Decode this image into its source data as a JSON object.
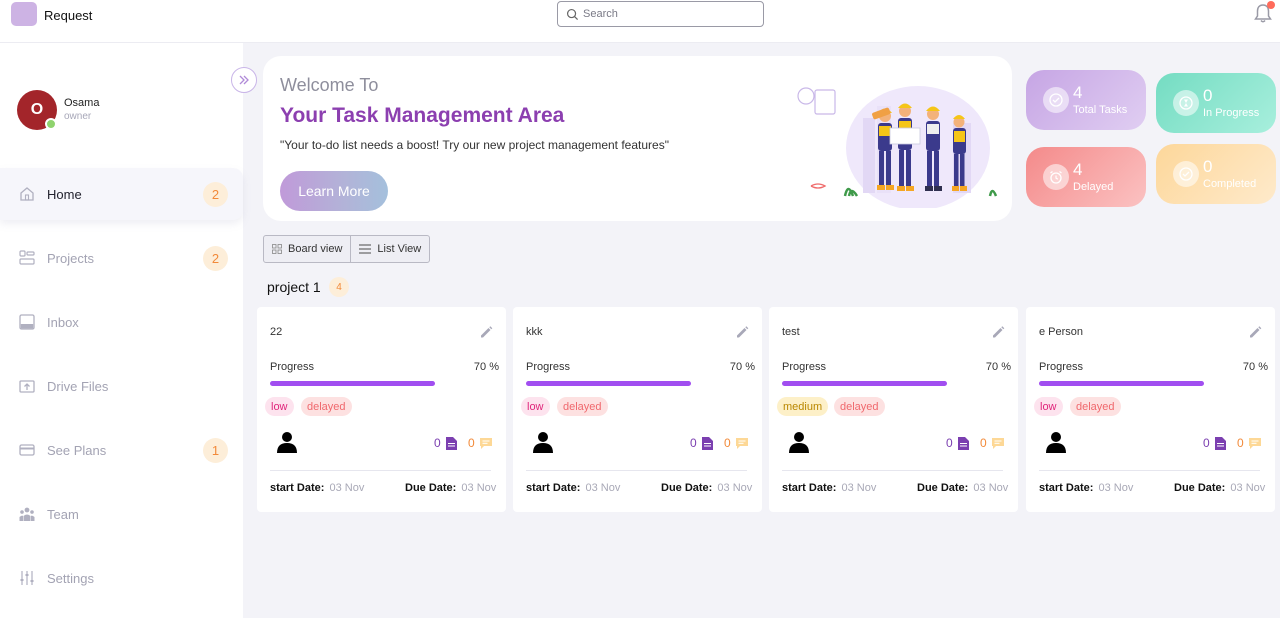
{
  "app": {
    "title": "Request"
  },
  "search": {
    "placeholder": "Search"
  },
  "user": {
    "initial": "O",
    "name": "Osama",
    "role": "owner"
  },
  "sidebar": {
    "items": [
      {
        "key": "home",
        "label": "Home",
        "badge": "2",
        "active": true
      },
      {
        "key": "projects",
        "label": "Projects",
        "badge": "2"
      },
      {
        "key": "inbox",
        "label": "Inbox",
        "badge": ""
      },
      {
        "key": "drive-files",
        "label": "Drive Files",
        "badge": ""
      },
      {
        "key": "see-plans",
        "label": "See Plans",
        "badge": "1"
      },
      {
        "key": "team",
        "label": "Team",
        "badge": ""
      },
      {
        "key": "settings",
        "label": "Settings",
        "badge": ""
      }
    ]
  },
  "hero": {
    "welcome": "Welcome To",
    "title": "Your Task Management Area",
    "subtitle": "\"Your to-do list needs a boost! Try our new project management features\"",
    "button": "Learn More"
  },
  "stats": [
    {
      "key": "total",
      "value": "4",
      "label": "Total Tasks",
      "color": "#d4b5ec"
    },
    {
      "key": "progress",
      "value": "0",
      "label": "In Progress",
      "color": "#8fe3cf"
    },
    {
      "key": "delayed",
      "value": "4",
      "label": "Delayed",
      "color": "#f7a2a2"
    },
    {
      "key": "completed",
      "value": "0",
      "label": "Completed",
      "color": "#fde1a9"
    }
  ],
  "views": {
    "board": "Board view",
    "list": "List View"
  },
  "project": {
    "name": "project 1",
    "count": "4"
  },
  "tasks": [
    {
      "name": "22",
      "progress_label": "Progress",
      "progress_text": "70 %",
      "progress": 0.7,
      "priority": "low",
      "status": "delayed",
      "files": "0",
      "comments": "0",
      "start_label": "start Date:",
      "start": "03 Nov",
      "due_label": "Due Date:",
      "due": "03 Nov"
    },
    {
      "name": "kkk",
      "progress_label": "Progress",
      "progress_text": "70 %",
      "progress": 0.7,
      "priority": "low",
      "status": "delayed",
      "files": "0",
      "comments": "0",
      "start_label": "start Date:",
      "start": "03 Nov",
      "due_label": "Due Date:",
      "due": "03 Nov"
    },
    {
      "name": "test",
      "progress_label": "Progress",
      "progress_text": "70 %",
      "progress": 0.7,
      "priority": "medium",
      "status": "delayed",
      "files": "0",
      "comments": "0",
      "start_label": "start Date:",
      "start": "03 Nov",
      "due_label": "Due Date:",
      "due": "03 Nov"
    },
    {
      "name": "e Person",
      "progress_label": "Progress",
      "progress_text": "70 %",
      "progress": 0.7,
      "priority": "low",
      "status": "delayed",
      "files": "0",
      "comments": "0",
      "start_label": "start Date:",
      "start": "03 Nov",
      "due_label": "Due Date:",
      "due": "03 Nov"
    }
  ]
}
